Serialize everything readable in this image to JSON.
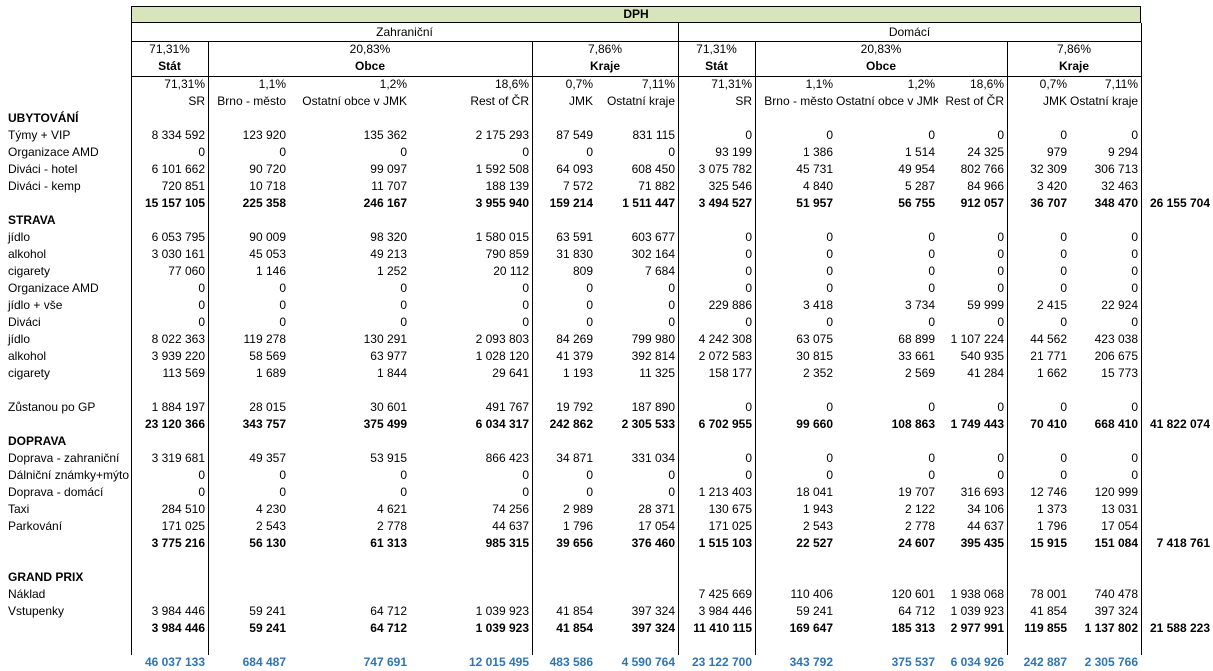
{
  "title": "DPH",
  "groups": [
    "Zahraniční",
    "Domácí"
  ],
  "subgroups": [
    {
      "pct": "71,31%",
      "name": "Stát"
    },
    {
      "pct": "20,83%",
      "name": "Obce"
    },
    {
      "pct": "7,86%",
      "name": "Kraje"
    },
    {
      "pct": "71,31%",
      "name": "Stát"
    },
    {
      "pct": "20,83%",
      "name": "Obce"
    },
    {
      "pct": "7,86%",
      "name": "Kraje"
    }
  ],
  "col_pcts": [
    "71,31%",
    "1,1%",
    "1,2%",
    "18,6%",
    "0,7%",
    "7,11%",
    "71,31%",
    "1,1%",
    "1,2%",
    "18,6%",
    "0,7%",
    "7,11%"
  ],
  "col_names": [
    "SR",
    "Brno - město",
    "Ostatní obce v JMK",
    "Rest of ČR",
    "JMK",
    "Ostatní kraje",
    "SR",
    "Brno - město",
    "Ostatní obce v JMK",
    "Rest of ČR",
    "JMK",
    "Ostatní kraje"
  ],
  "rows": [
    {
      "label": "UBYTOVÁNÍ",
      "type": "section",
      "values": [],
      "extra": ""
    },
    {
      "label": "Týmy + VIP",
      "type": "data",
      "values": [
        "8 334 592",
        "123 920",
        "135 362",
        "2 175 293",
        "87 549",
        "831 115",
        "0",
        "0",
        "0",
        "0",
        "0",
        "0"
      ],
      "extra": ""
    },
    {
      "label": "Organizace AMD",
      "type": "data",
      "values": [
        "0",
        "0",
        "0",
        "0",
        "0",
        "0",
        "93 199",
        "1 386",
        "1 514",
        "24 325",
        "979",
        "9 294"
      ],
      "extra": ""
    },
    {
      "label": "Diváci - hotel",
      "type": "data",
      "values": [
        "6 101 662",
        "90 720",
        "99 097",
        "1 592 508",
        "64 093",
        "608 450",
        "3 075 782",
        "45 731",
        "49 954",
        "802 766",
        "32 309",
        "306 713"
      ],
      "extra": ""
    },
    {
      "label": "Diváci - kemp",
      "type": "data",
      "values": [
        "720 851",
        "10 718",
        "11 707",
        "188 139",
        "7 572",
        "71 882",
        "325 546",
        "4 840",
        "5 287",
        "84 966",
        "3 420",
        "32 463"
      ],
      "extra": ""
    },
    {
      "label": "",
      "type": "total",
      "values": [
        "15 157 105",
        "225 358",
        "246 167",
        "3 955 940",
        "159 214",
        "1 511 447",
        "3 494 527",
        "51 957",
        "56 755",
        "912 057",
        "36 707",
        "348 470"
      ],
      "extra": "26 155 704"
    },
    {
      "label": "STRAVA",
      "type": "section",
      "values": [],
      "extra": ""
    },
    {
      "label": "jídlo",
      "type": "data",
      "values": [
        "6 053 795",
        "90 009",
        "98 320",
        "1 580 015",
        "63 591",
        "603 677",
        "0",
        "0",
        "0",
        "0",
        "0",
        "0"
      ],
      "extra": ""
    },
    {
      "label": "alkohol",
      "type": "data",
      "values": [
        "3 030 161",
        "45 053",
        "49 213",
        "790 859",
        "31 830",
        "302 164",
        "0",
        "0",
        "0",
        "0",
        "0",
        "0"
      ],
      "extra": ""
    },
    {
      "label": "cigarety",
      "type": "data",
      "values": [
        "77 060",
        "1 146",
        "1 252",
        "20 112",
        "809",
        "7 684",
        "0",
        "0",
        "0",
        "0",
        "0",
        "0"
      ],
      "extra": ""
    },
    {
      "label": "Organizace AMD",
      "type": "data",
      "values": [
        "0",
        "0",
        "0",
        "0",
        "0",
        "0",
        "0",
        "0",
        "0",
        "0",
        "0",
        "0"
      ],
      "extra": ""
    },
    {
      "label": "jídlo + vše",
      "type": "data",
      "values": [
        "0",
        "0",
        "0",
        "0",
        "0",
        "0",
        "229 886",
        "3 418",
        "3 734",
        "59 999",
        "2 415",
        "22 924"
      ],
      "extra": ""
    },
    {
      "label": "Diváci",
      "type": "data",
      "values": [
        "0",
        "0",
        "0",
        "0",
        "0",
        "0",
        "0",
        "0",
        "0",
        "0",
        "0",
        "0"
      ],
      "extra": ""
    },
    {
      "label": "jídlo",
      "type": "data",
      "values": [
        "8 022 363",
        "119 278",
        "130 291",
        "2 093 803",
        "84 269",
        "799 980",
        "4 242 308",
        "63 075",
        "68 899",
        "1 107 224",
        "44 562",
        "423 038"
      ],
      "extra": ""
    },
    {
      "label": "alkohol",
      "type": "data",
      "values": [
        "3 939 220",
        "58 569",
        "63 977",
        "1 028 120",
        "41 379",
        "392 814",
        "2 072 583",
        "30 815",
        "33 661",
        "540 935",
        "21 771",
        "206 675"
      ],
      "extra": ""
    },
    {
      "label": "cigarety",
      "type": "data",
      "values": [
        "113 569",
        "1 689",
        "1 844",
        "29 641",
        "1 193",
        "11 325",
        "158 177",
        "2 352",
        "2 569",
        "41 284",
        "1 662",
        "15 773"
      ],
      "extra": ""
    },
    {
      "label": "",
      "type": "blank",
      "values": [],
      "extra": ""
    },
    {
      "label": "Zůstanou po GP",
      "type": "data",
      "values": [
        "1 884 197",
        "28 015",
        "30 601",
        "491 767",
        "19 792",
        "187 890",
        "0",
        "0",
        "0",
        "0",
        "0",
        "0"
      ],
      "extra": ""
    },
    {
      "label": "",
      "type": "total",
      "values": [
        "23 120 366",
        "343 757",
        "375 499",
        "6 034 317",
        "242 862",
        "2 305 533",
        "6 702 955",
        "99 660",
        "108 863",
        "1 749 443",
        "70 410",
        "668 410"
      ],
      "extra": "41 822 074"
    },
    {
      "label": "DOPRAVA",
      "type": "section",
      "values": [],
      "extra": ""
    },
    {
      "label": "Doprava - zahraniční",
      "type": "data",
      "values": [
        "3 319 681",
        "49 357",
        "53 915",
        "866 423",
        "34 871",
        "331 034",
        "0",
        "0",
        "0",
        "0",
        "0",
        "0"
      ],
      "extra": ""
    },
    {
      "label": "Dálniční známky+mýto",
      "type": "data",
      "values": [
        "0",
        "0",
        "0",
        "0",
        "0",
        "0",
        "0",
        "0",
        "0",
        "0",
        "0",
        "0"
      ],
      "extra": ""
    },
    {
      "label": "Doprava - domácí",
      "type": "data",
      "values": [
        "0",
        "0",
        "0",
        "0",
        "0",
        "0",
        "1 213 403",
        "18 041",
        "19 707",
        "316 693",
        "12 746",
        "120 999"
      ],
      "extra": ""
    },
    {
      "label": "Taxi",
      "type": "data",
      "values": [
        "284 510",
        "4 230",
        "4 621",
        "74 256",
        "2 989",
        "28 371",
        "130 675",
        "1 943",
        "2 122",
        "34 106",
        "1 373",
        "13 031"
      ],
      "extra": ""
    },
    {
      "label": "Parkování",
      "type": "data",
      "values": [
        "171 025",
        "2 543",
        "2 778",
        "44 637",
        "1 796",
        "17 054",
        "171 025",
        "2 543",
        "2 778",
        "44 637",
        "1 796",
        "17 054"
      ],
      "extra": ""
    },
    {
      "label": "",
      "type": "total",
      "values": [
        "3 775 216",
        "56 130",
        "61 313",
        "985 315",
        "39 656",
        "376 460",
        "1 515 103",
        "22 527",
        "24 607",
        "395 435",
        "15 915",
        "151 084"
      ],
      "extra": "7 418 761"
    },
    {
      "label": "",
      "type": "blank",
      "values": [],
      "extra": ""
    },
    {
      "label": "GRAND PRIX",
      "type": "section",
      "values": [],
      "extra": ""
    },
    {
      "label": "Náklad",
      "type": "data",
      "values": [
        "",
        "",
        "",
        "",
        "",
        "",
        "7 425 669",
        "110 406",
        "120 601",
        "1 938 068",
        "78 001",
        "740 478"
      ],
      "extra": ""
    },
    {
      "label": "Vstupenky",
      "type": "data",
      "values": [
        "3 984 446",
        "59 241",
        "64 712",
        "1 039 923",
        "41 854",
        "397 324",
        "3 984 446",
        "59 241",
        "64 712",
        "1 039 923",
        "41 854",
        "397 324"
      ],
      "extra": ""
    },
    {
      "label": "",
      "type": "total",
      "values": [
        "3 984 446",
        "59 241",
        "64 712",
        "1 039 923",
        "41 854",
        "397 324",
        "11 410 115",
        "169 647",
        "185 313",
        "2 977 991",
        "119 855",
        "1 137 802"
      ],
      "extra": "21 588 223"
    },
    {
      "label": "",
      "type": "blank",
      "values": [],
      "extra": ""
    },
    {
      "label": "",
      "type": "grand",
      "values": [
        "46 037 133",
        "684 487",
        "747 691",
        "12 015 495",
        "483 586",
        "4 590 764",
        "23 122 700",
        "343 792",
        "375 537",
        "6 034 926",
        "242 887",
        "2 305 766"
      ],
      "extra": ""
    }
  ],
  "colors": {
    "header_fill": "#D8E4BC",
    "grand_total_text": "#2E75B6"
  }
}
